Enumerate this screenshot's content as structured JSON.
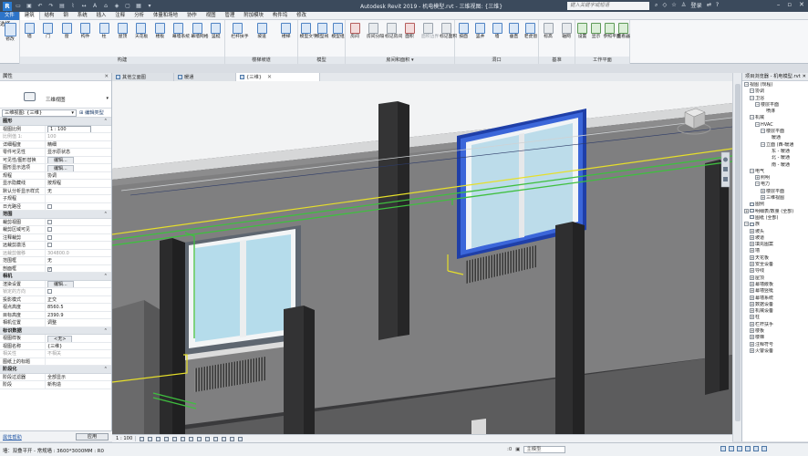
{
  "titlebar": {
    "logo": "R",
    "title": "Autodesk Revit 2019 - 机电模型.rvt - 三维视图: {三维}",
    "search_placeholder": "键入关键字或短语",
    "signin": "登录",
    "help": "?",
    "minimize": "–",
    "restore": "▫",
    "close": "✕"
  },
  "menu": {
    "items": [
      "文件",
      "建筑",
      "结构",
      "钢",
      "系统",
      "插入",
      "注释",
      "分析",
      "体量和场地",
      "协作",
      "视图",
      "管理",
      "附加模块",
      "构件坞",
      "修改"
    ]
  },
  "ribbon": {
    "select_label": "选择 ▾",
    "modify_label": "修改",
    "groups": [
      {
        "label": "构建",
        "buttons": [
          "墙",
          "门",
          "窗",
          "构件",
          "柱",
          "屋顶",
          "天花板",
          "楼板",
          "幕墙系统",
          "幕墙网格",
          "竖梃"
        ]
      },
      {
        "label": "楼梯坡道",
        "buttons": [
          "栏杆扶手",
          "坡道",
          "楼梯"
        ]
      },
      {
        "label": "模型",
        "buttons": [
          "模型文字",
          "模型线",
          "模型组"
        ]
      },
      {
        "label": "房间和面积 ▾",
        "buttons": [
          "房间",
          "房间分隔",
          "标记房间",
          "面积",
          "面积边界",
          "标记面积"
        ]
      },
      {
        "label": "洞口",
        "buttons": [
          "按面",
          "竖井",
          "墙",
          "垂直",
          "老虎窗"
        ]
      },
      {
        "label": "基准",
        "buttons": [
          "标高",
          "轴网"
        ]
      },
      {
        "label": "工作平面",
        "buttons": [
          "设置",
          "显示",
          "参照平面",
          "查看器"
        ]
      }
    ]
  },
  "tabs": [
    {
      "label": "其他立面图",
      "active": false
    },
    {
      "label": "暖通",
      "active": false
    },
    {
      "label": "{三维}",
      "active": true
    }
  ],
  "properties": {
    "title": "属性",
    "type_name": "三维视图",
    "filter": "三维视图: {三维}",
    "edit_type": "编辑类型",
    "sections": [
      {
        "name": "图形",
        "rows": [
          {
            "k": "视图比例",
            "v": "1 : 100",
            "kind": "input"
          },
          {
            "k": "比例值 1:",
            "v": "100",
            "dim": true
          },
          {
            "k": "详细程度",
            "v": "精细"
          },
          {
            "k": "零件可见性",
            "v": "显示原状态"
          },
          {
            "k": "可见性/图形替换",
            "v": "编辑...",
            "kind": "button"
          },
          {
            "k": "图形显示选项",
            "v": "编辑...",
            "kind": "button"
          },
          {
            "k": "规程",
            "v": "协调"
          },
          {
            "k": "显示隐藏线",
            "v": "按规程"
          },
          {
            "k": "默认分析显示样式",
            "v": "无"
          },
          {
            "k": "子规程",
            "v": ""
          },
          {
            "k": "日光路径",
            "v": "",
            "kind": "check"
          }
        ]
      },
      {
        "name": "范围",
        "rows": [
          {
            "k": "裁剪视图",
            "v": "",
            "kind": "check"
          },
          {
            "k": "裁剪区域可见",
            "v": "",
            "kind": "check"
          },
          {
            "k": "注释裁剪",
            "v": "",
            "kind": "check"
          },
          {
            "k": "远裁剪激活",
            "v": "",
            "kind": "check"
          },
          {
            "k": "远裁剪偏移",
            "v": "304800.0",
            "dim": true
          },
          {
            "k": "范围框",
            "v": "无"
          },
          {
            "k": "剖面框",
            "v": "",
            "kind": "check",
            "checked": true
          }
        ]
      },
      {
        "name": "相机",
        "rows": [
          {
            "k": "渲染设置",
            "v": "编辑...",
            "kind": "button"
          },
          {
            "k": "锁定的方向",
            "v": "",
            "kind": "check",
            "dim": true
          },
          {
            "k": "投影模式",
            "v": "正交"
          },
          {
            "k": "视点高度",
            "v": "8560.5"
          },
          {
            "k": "目标高度",
            "v": "2390.9"
          },
          {
            "k": "相机位置",
            "v": "调整"
          }
        ]
      },
      {
        "name": "标识数据",
        "rows": [
          {
            "k": "视图样板",
            "v": "<无>",
            "kind": "button"
          },
          {
            "k": "视图名称",
            "v": "{三维}"
          },
          {
            "k": "相关性",
            "v": "不相关",
            "dim": true
          },
          {
            "k": "图纸上的标题",
            "v": ""
          }
        ]
      },
      {
        "name": "阶段化",
        "rows": [
          {
            "k": "阶段过滤器",
            "v": "全部显示"
          },
          {
            "k": "阶段",
            "v": "新构造"
          }
        ]
      }
    ],
    "help_link": "属性帮助",
    "apply": "应用"
  },
  "view_control": {
    "scale": "1 : 100"
  },
  "browser": {
    "title": "项目浏览器 - 机电模型.rvt",
    "nodes": [
      {
        "d": 0,
        "t": "−",
        "label": "视图 (规程)"
      },
      {
        "d": 1,
        "t": "−",
        "label": "协调"
      },
      {
        "d": 1,
        "t": "−",
        "label": "卫浴"
      },
      {
        "d": 2,
        "t": "−",
        "label": "楼层平面"
      },
      {
        "d": 3,
        "t": "",
        "label": "喷淋"
      },
      {
        "d": 1,
        "t": "−",
        "label": "机械"
      },
      {
        "d": 2,
        "t": "−",
        "label": "HVAC"
      },
      {
        "d": 3,
        "t": "−",
        "label": "楼层平面"
      },
      {
        "d": 4,
        "t": "",
        "label": "暖通"
      },
      {
        "d": 3,
        "t": "−",
        "label": "立面 (西-暖通"
      },
      {
        "d": 4,
        "t": "",
        "label": "东 - 暖通"
      },
      {
        "d": 4,
        "t": "",
        "label": "北 - 暖通"
      },
      {
        "d": 4,
        "t": "",
        "label": "南 - 暖通"
      },
      {
        "d": 1,
        "t": "−",
        "label": "电气"
      },
      {
        "d": 2,
        "t": "+",
        "label": "照明"
      },
      {
        "d": 2,
        "t": "−",
        "label": "电力"
      },
      {
        "d": 3,
        "t": "+",
        "label": "楼层平面"
      },
      {
        "d": 3,
        "t": "+",
        "label": "三维视图"
      },
      {
        "d": 0,
        "t": "",
        "label": "图例",
        "icon": true
      },
      {
        "d": 0,
        "t": "+",
        "label": "明细表/数量 (全部)",
        "icon": true
      },
      {
        "d": 0,
        "t": "",
        "label": "图纸 (全部)",
        "icon": true
      },
      {
        "d": 0,
        "t": "−",
        "label": "族",
        "icon": true
      },
      {
        "d": 1,
        "t": "+",
        "label": "坡头"
      },
      {
        "d": 1,
        "t": "+",
        "label": "坡道"
      },
      {
        "d": 1,
        "t": "+",
        "label": "填充图案"
      },
      {
        "d": 1,
        "t": "+",
        "label": "墙"
      },
      {
        "d": 1,
        "t": "+",
        "label": "天花板"
      },
      {
        "d": 1,
        "t": "+",
        "label": "安全设备"
      },
      {
        "d": 1,
        "t": "+",
        "label": "导线"
      },
      {
        "d": 1,
        "t": "+",
        "label": "屋顶"
      },
      {
        "d": 1,
        "t": "+",
        "label": "幕墙嵌板"
      },
      {
        "d": 1,
        "t": "+",
        "label": "幕墙竖梃"
      },
      {
        "d": 1,
        "t": "+",
        "label": "幕墙系统"
      },
      {
        "d": 1,
        "t": "+",
        "label": "数据设备"
      },
      {
        "d": 1,
        "t": "+",
        "label": "机械设备"
      },
      {
        "d": 1,
        "t": "+",
        "label": "柱"
      },
      {
        "d": 1,
        "t": "+",
        "label": "栏杆扶手"
      },
      {
        "d": 1,
        "t": "+",
        "label": "楼板"
      },
      {
        "d": 1,
        "t": "+",
        "label": "楼梯"
      },
      {
        "d": 1,
        "t": "+",
        "label": "注释符号"
      },
      {
        "d": 1,
        "t": "+",
        "label": "火警设备"
      }
    ]
  },
  "statusbar": {
    "status": "墙：双叠平开 - 常规墙 : 3600*3000MM : R0",
    "model_box": "主模型",
    "zero": ":0"
  },
  "colors": {
    "ribbon_accent": "#2e74c8",
    "duct_green": "#3fbf3f",
    "selection_blue": "#2a59d6",
    "section_box_yellow": "#e6df2a"
  }
}
